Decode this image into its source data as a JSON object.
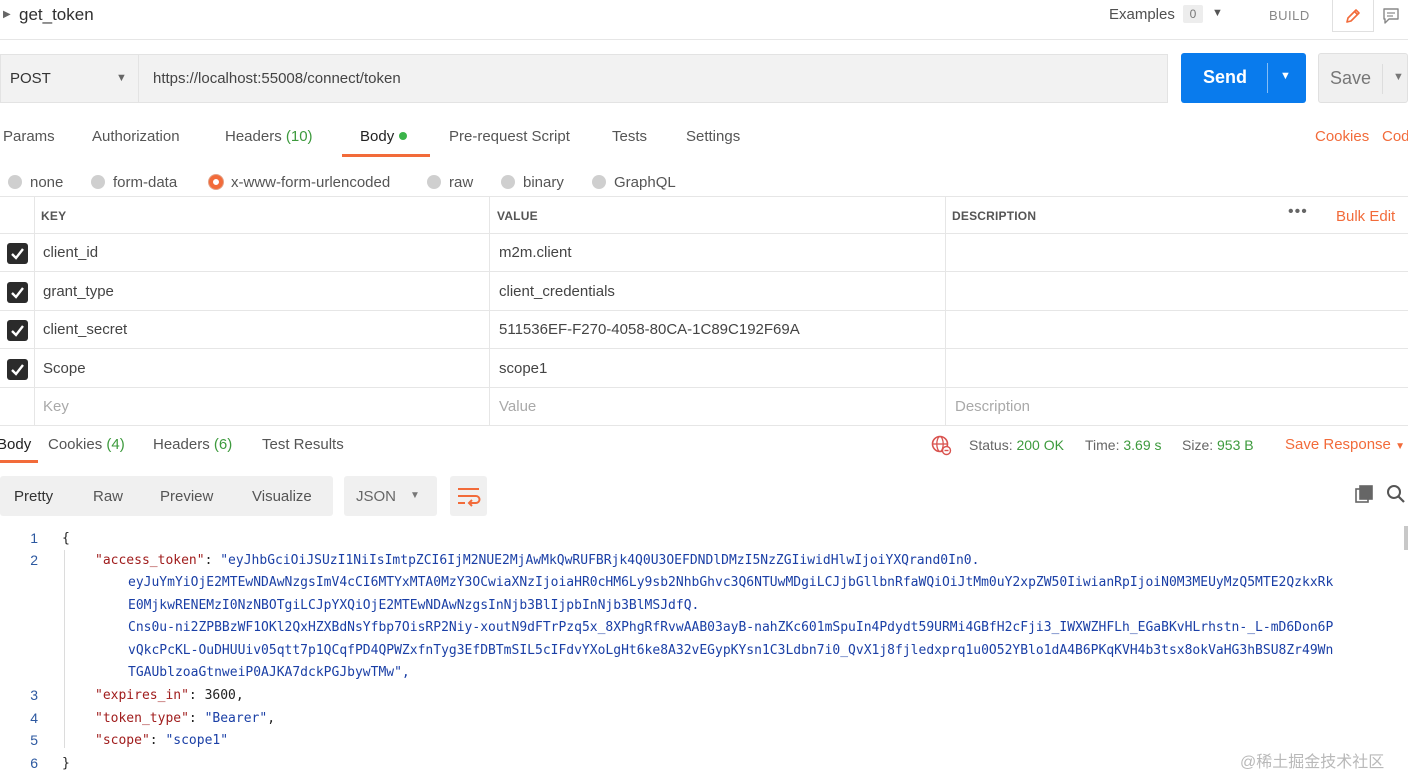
{
  "header": {
    "title": "get_token",
    "examples_label": "Examples",
    "examples_count": "0",
    "build_label": "BUILD"
  },
  "request": {
    "method": "POST",
    "url": "https://localhost:55008/connect/token",
    "send_label": "Send",
    "save_label": "Save"
  },
  "request_tabs": [
    {
      "label": "Params"
    },
    {
      "label": "Authorization"
    },
    {
      "label": "Headers",
      "count": "(10)"
    },
    {
      "label": "Body"
    },
    {
      "label": "Pre-request Script"
    },
    {
      "label": "Tests"
    },
    {
      "label": "Settings"
    }
  ],
  "right_links": {
    "cookies": "Cookies",
    "code": "Cod"
  },
  "body_types": [
    {
      "label": "none",
      "selected": false
    },
    {
      "label": "form-data",
      "selected": false
    },
    {
      "label": "x-www-form-urlencoded",
      "selected": true
    },
    {
      "label": "raw",
      "selected": false
    },
    {
      "label": "binary",
      "selected": false
    },
    {
      "label": "GraphQL",
      "selected": false
    }
  ],
  "params_table": {
    "headers": {
      "key": "KEY",
      "value": "VALUE",
      "description": "DESCRIPTION"
    },
    "more_label": "•••",
    "bulk_edit": "Bulk Edit",
    "rows": [
      {
        "checked": true,
        "key": "client_id",
        "value": "m2m.client",
        "description": ""
      },
      {
        "checked": true,
        "key": "grant_type",
        "value": "client_credentials",
        "description": ""
      },
      {
        "checked": true,
        "key": "client_secret",
        "value": "511536EF-F270-4058-80CA-1C89C192F69A",
        "description": ""
      },
      {
        "checked": true,
        "key": "Scope",
        "value": "scope1",
        "description": ""
      }
    ],
    "placeholders": {
      "key": "Key",
      "value": "Value",
      "description": "Description"
    }
  },
  "response": {
    "tabs": [
      {
        "label": "Body"
      },
      {
        "label": "Cookies",
        "count": "(4)"
      },
      {
        "label": "Headers",
        "count": "(6)"
      },
      {
        "label": "Test Results"
      }
    ],
    "status_label": "Status:",
    "status_value": "200 OK",
    "time_label": "Time:",
    "time_value": "3.69 s",
    "size_label": "Size:",
    "size_value": "953 B",
    "save_response": "Save Response"
  },
  "view": {
    "modes": [
      "Pretty",
      "Raw",
      "Preview",
      "Visualize"
    ],
    "active_mode": "Pretty",
    "format": "JSON"
  },
  "code": {
    "line_numbers": [
      "1",
      "2",
      "3",
      "4",
      "5",
      "6"
    ],
    "open_brace": "{",
    "close_brace": "}",
    "access_token_key": "\"access_token\"",
    "access_token_lines": [
      "\"eyJhbGciOiJSUzI1NiIsImtpZCI6IjM2NUE2MjAwMkQwRUFBRjk4Q0U3OEFDNDlDMzI5NzZGIiwidHlwIjoiYXQrand0In0.",
      "eyJuYmYiOjE2MTEwNDAwNzgsImV4cCI6MTYxMTA0MzY3OCwiaXNzIjoiaHR0cHM6Ly9sb2NhbGhvc3Q6NTUwMDgiLCJjbGllbnRfaWQiOiJtMm0uY2xpZW50IiwianRpIjoiN0M3MEUyMzQ5MTE2QzkxRk",
      "E0MjkwRENEMzI0NzNBOTgiLCJpYXQiOjE2MTEwNDAwNzgsInNjb3BlIjpbInNjb3BlMSJdfQ.",
      "Cns0u-ni2ZPBBzWF1OKl2QxHZXBdNsYfbp7OisRP2Niy-xoutN9dFTrPzq5x_8XPhgRfRvwAAB03ayB-nahZKc601mSpuIn4Pdydt59URMi4GBfH2cFji3_IWXWZHFLh_EGaBKvHLrhstn-_L-mD6Don6P",
      "vQkcPcKL-OuDHUUiv05qtt7p1QCqfPD4QPWZxfnTyg3EfDBTmSIL5cIFdvYXoLgHt6ke8A32vEGypKYsn1C3Ldbn7i0_QvX1j8fjledxprq1u0O52YBlo1dA4B6PKqKVH4b3tsx8okVaHG3hBSU8Zr49Wn",
      "TGAUblzoaGtnweiP0AJKA7dckPGJbywTMw\","
    ],
    "expires_in_key": "\"expires_in\"",
    "expires_in_value": "3600",
    "token_type_key": "\"token_type\"",
    "token_type_value": "\"Bearer\"",
    "scope_key": "\"scope\"",
    "scope_value": "\"scope1\""
  },
  "watermark": "@稀土掘金技术社区",
  "colors": {
    "accent": "#f26b3a",
    "send_blue": "#097bed",
    "success_green": "#3d9a3d",
    "json_key": "#a01d1d",
    "json_string": "#1a3fa6"
  },
  "icons": {
    "edit": "pencil-icon",
    "comments": "comment-icon",
    "globe": "globe-icon",
    "wrap": "wrap-lines-icon",
    "copy": "copy-icon",
    "search": "search-icon"
  }
}
